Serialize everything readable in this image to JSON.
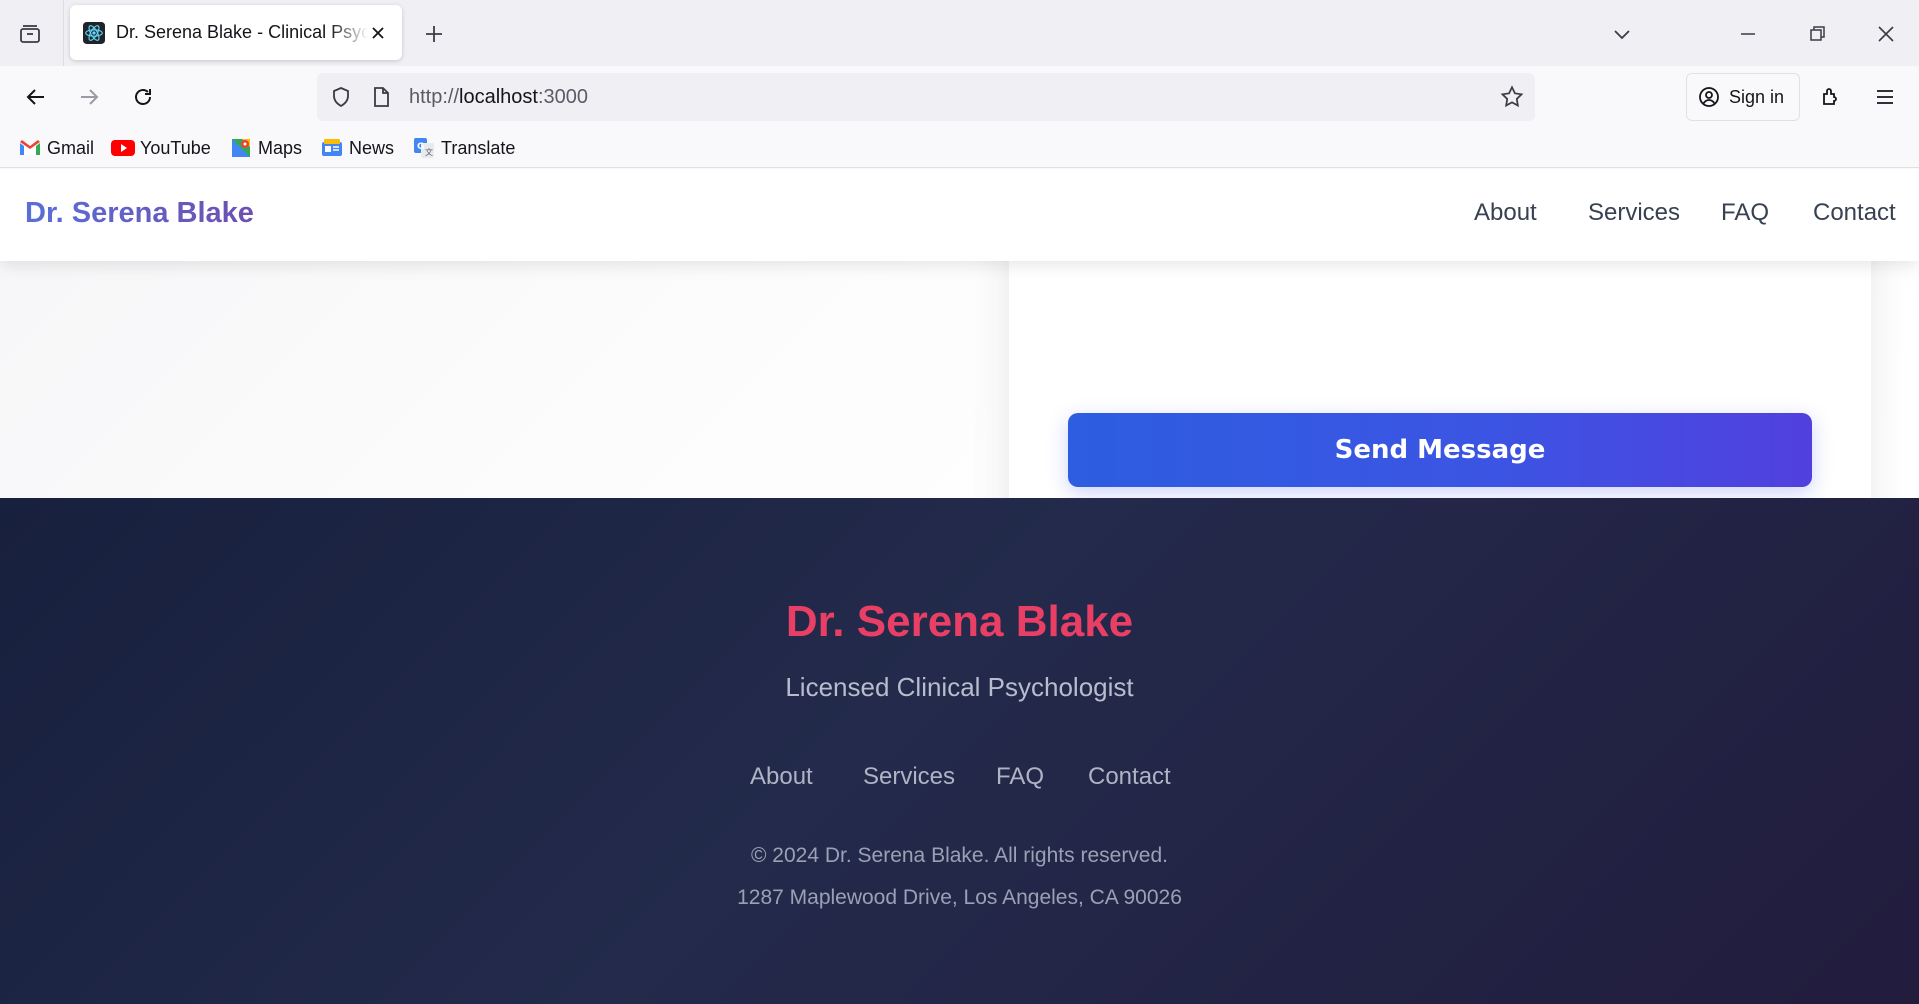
{
  "browser": {
    "tab": {
      "title": "Dr. Serena Blake - Clinical Psychologist",
      "favicon": "react-icon"
    },
    "url": {
      "scheme": "http://",
      "host": "localhost",
      "port": ":3000"
    },
    "sign_in_label": "Sign in",
    "bookmarks": [
      {
        "label": "Gmail",
        "icon": "gmail-icon"
      },
      {
        "label": "YouTube",
        "icon": "youtube-icon"
      },
      {
        "label": "Maps",
        "icon": "maps-icon"
      },
      {
        "label": "News",
        "icon": "news-icon"
      },
      {
        "label": "Translate",
        "icon": "translate-icon"
      }
    ]
  },
  "site": {
    "brand": "Dr. Serena Blake",
    "nav": [
      "About",
      "Services",
      "FAQ",
      "Contact"
    ],
    "form": {
      "submit_label": "Send Message"
    },
    "footer": {
      "name": "Dr. Serena Blake",
      "subtitle": "Licensed Clinical Psychologist",
      "links": [
        "About",
        "Services",
        "FAQ",
        "Contact"
      ],
      "copyright": "© 2024 Dr. Serena Blake. All rights reserved.",
      "address": "1287 Maplewood Drive, Los Angeles, CA 90026"
    }
  },
  "colors": {
    "brand_gradient": [
      "#5a6fd8",
      "#6d4fb0"
    ],
    "button_gradient": [
      "#2d5de0",
      "#5140de"
    ],
    "footer_bg": "#17203d",
    "footer_name": "#ea3f64"
  }
}
